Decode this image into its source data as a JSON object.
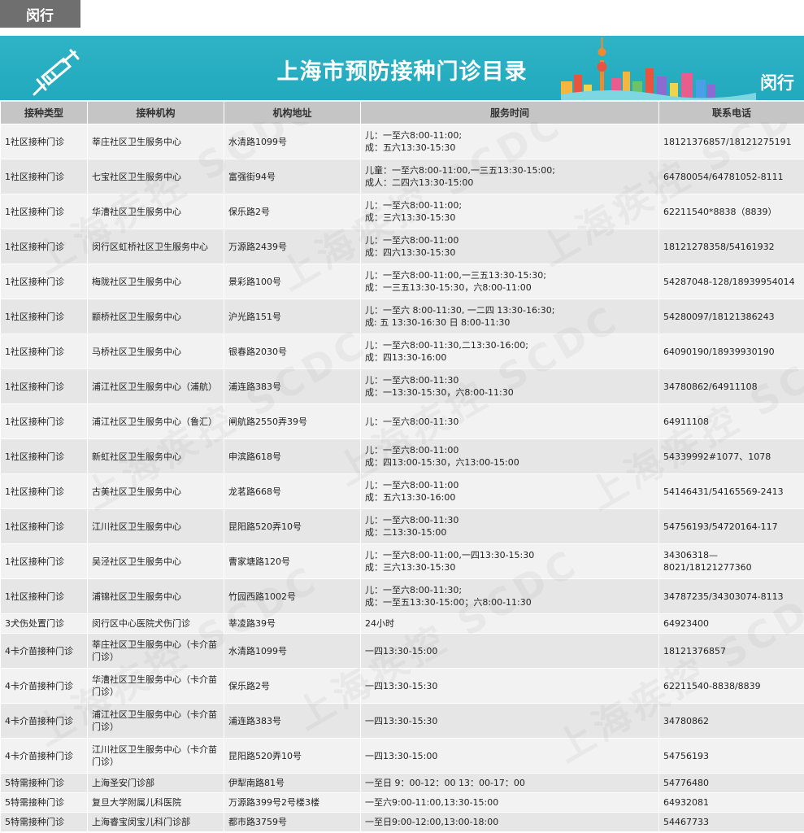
{
  "tag": "闵行",
  "banner": {
    "title": "上海市预防接种门诊目录",
    "district": "闵行"
  },
  "watermark": "上海疾控 SCDC",
  "headers": [
    "接种类型",
    "接种机构",
    "机构地址",
    "服务时间",
    "联系电话"
  ],
  "rows": [
    {
      "type": "1社区接种门诊",
      "org": "莘庄社区卫生服务中心",
      "addr": "水清路1099号",
      "hours": [
        "儿：一至六8:00-11:00;",
        "成：五六13:30-15:30"
      ],
      "phone": "18121376857/18121275191"
    },
    {
      "type": "1社区接种门诊",
      "org": "七宝社区卫生服务中心",
      "addr": "富强街94号",
      "hours": [
        "儿童：一至六8:00-11:00,一三五13:30-15:00;",
        "成人：二四六13:30-15:00"
      ],
      "phone": "64780054/64781052-8111"
    },
    {
      "type": "1社区接种门诊",
      "org": "华漕社区卫生服务中心",
      "addr": "保乐路2号",
      "hours": [
        "儿：一至六8:00-11:00;",
        "成：三六13:30-15:30"
      ],
      "phone": "62211540*8838（8839）"
    },
    {
      "type": "1社区接种门诊",
      "org": "闵行区虹桥社区卫生服务中心",
      "addr": "万源路2439号",
      "hours": [
        "儿：一至六8:00-11:00",
        "成：四六13:30-15:30"
      ],
      "phone": "18121278358/54161932"
    },
    {
      "type": "1社区接种门诊",
      "org": "梅陇社区卫生服务中心",
      "addr": "景彩路100号",
      "hours": [
        "儿：一至六8:00-11:00,一三五13:30-15:30;",
        "成：一三五13:30-15:30，六8:00-11:00"
      ],
      "phone": "54287048-128/18939954014"
    },
    {
      "type": "1社区接种门诊",
      "org": "颛桥社区卫生服务中心",
      "addr": "沪光路151号",
      "hours": [
        "儿：一至六 8:00-11:30, 一二四 13:30-16:30;",
        "成: 五 13:30-16:30 日 8:00-11:30"
      ],
      "phone": "54280097/18121386243"
    },
    {
      "type": "1社区接种门诊",
      "org": "马桥社区卫生服务中心",
      "addr": "银春路2030号",
      "hours": [
        "儿：一至六8:00-11:30,二13:30-16:00;",
        "成：四13:30-16:00"
      ],
      "phone": "64090190/18939930190"
    },
    {
      "type": "1社区接种门诊",
      "org": "浦江社区卫生服务中心（浦航）",
      "addr": "浦连路383号",
      "hours": [
        "儿：一至六8:00-11:30",
        "成：一13:30-15:30，六8:00-11:30"
      ],
      "phone": "34780862/64911108"
    },
    {
      "type": "1社区接种门诊",
      "org": "浦江社区卫生服务中心（鲁汇）",
      "addr": "闸航路2550弄39号",
      "hours": [
        "儿：一至六8:00-11:30"
      ],
      "phone": "64911108"
    },
    {
      "type": "1社区接种门诊",
      "org": "新虹社区卫生服务中心",
      "addr": "申滨路618号",
      "hours": [
        "儿：一至六8:00-11:00",
        "成：四13:00-15:30，六13:00-15:00"
      ],
      "phone": "54339992#1077、1078"
    },
    {
      "type": "1社区接种门诊",
      "org": "古美社区卫生服务中心",
      "addr": "龙茗路668号",
      "hours": [
        "儿：一至六8:00-11:00",
        "成：五六13:30-16:00"
      ],
      "phone": "54146431/54165569-2413"
    },
    {
      "type": "1社区接种门诊",
      "org": "江川社区卫生服务中心",
      "addr": "昆阳路520弄10号",
      "hours": [
        "儿：一至六8:00-11:30",
        "成：二13:30-15:00"
      ],
      "phone": "54756193/54720164-117"
    },
    {
      "type": "1社区接种门诊",
      "org": "吴泾社区卫生服务中心",
      "addr": "曹家塘路120号",
      "hours": [
        "儿：一至六8:00-11:00,一四13:30-15:30",
        "成：三六13:30-15:30"
      ],
      "phone": "34306318—8021/18121277360"
    },
    {
      "type": "1社区接种门诊",
      "org": "浦锦社区卫生服务中心",
      "addr": "竹园西路1002号",
      "hours": [
        "儿：一至六8:00-11:30;",
        "成：一至五13:30-15:00；六8:00-11:30"
      ],
      "phone": "34787235/34303074-8113"
    },
    {
      "type": "3犬伤处置门诊",
      "org": "闵行区中心医院犬伤门诊",
      "addr": "莘凌路39号",
      "hours": [
        "24小时"
      ],
      "phone": "64923400"
    },
    {
      "type": "4卡介苗接种门诊",
      "org": "莘庄社区卫生服务中心（卡介苗门诊）",
      "addr": "水清路1099号",
      "hours": [
        "一四13:30-15:00"
      ],
      "phone": "18121376857"
    },
    {
      "type": "4卡介苗接种门诊",
      "org": "华漕社区卫生服务中心（卡介苗门诊）",
      "addr": "保乐路2号",
      "hours": [
        "一四13:30-15:30"
      ],
      "phone": "62211540-8838/8839"
    },
    {
      "type": "4卡介苗接种门诊",
      "org": "浦江社区卫生服务中心（卡介苗门诊）",
      "addr": "浦连路383号",
      "hours": [
        "一四13:30-15:30"
      ],
      "phone": "34780862"
    },
    {
      "type": "4卡介苗接种门诊",
      "org": "江川社区卫生服务中心（卡介苗门诊）",
      "addr": "昆阳路520弄10号",
      "hours": [
        "一四13:30-15:00"
      ],
      "phone": "54756193"
    },
    {
      "type": "5特需接种门诊",
      "org": "上海圣安门诊部",
      "addr": "伊犁南路81号",
      "hours": [
        "一至日 9：00-12：00 13：00-17：00"
      ],
      "phone": "54776480"
    },
    {
      "type": "5特需接种门诊",
      "org": "复旦大学附属儿科医院",
      "addr": "万源路399号2号楼3楼",
      "hours": [
        "一至六9:00-11:00,13:30-15:00"
      ],
      "phone": "64932081"
    },
    {
      "type": "5特需接种门诊",
      "org": "上海睿宝闵宝儿科门诊部",
      "addr": "都市路3759号",
      "hours": [
        "一至日9:00-12:00,13:00-18:00"
      ],
      "phone": "54467733"
    }
  ]
}
